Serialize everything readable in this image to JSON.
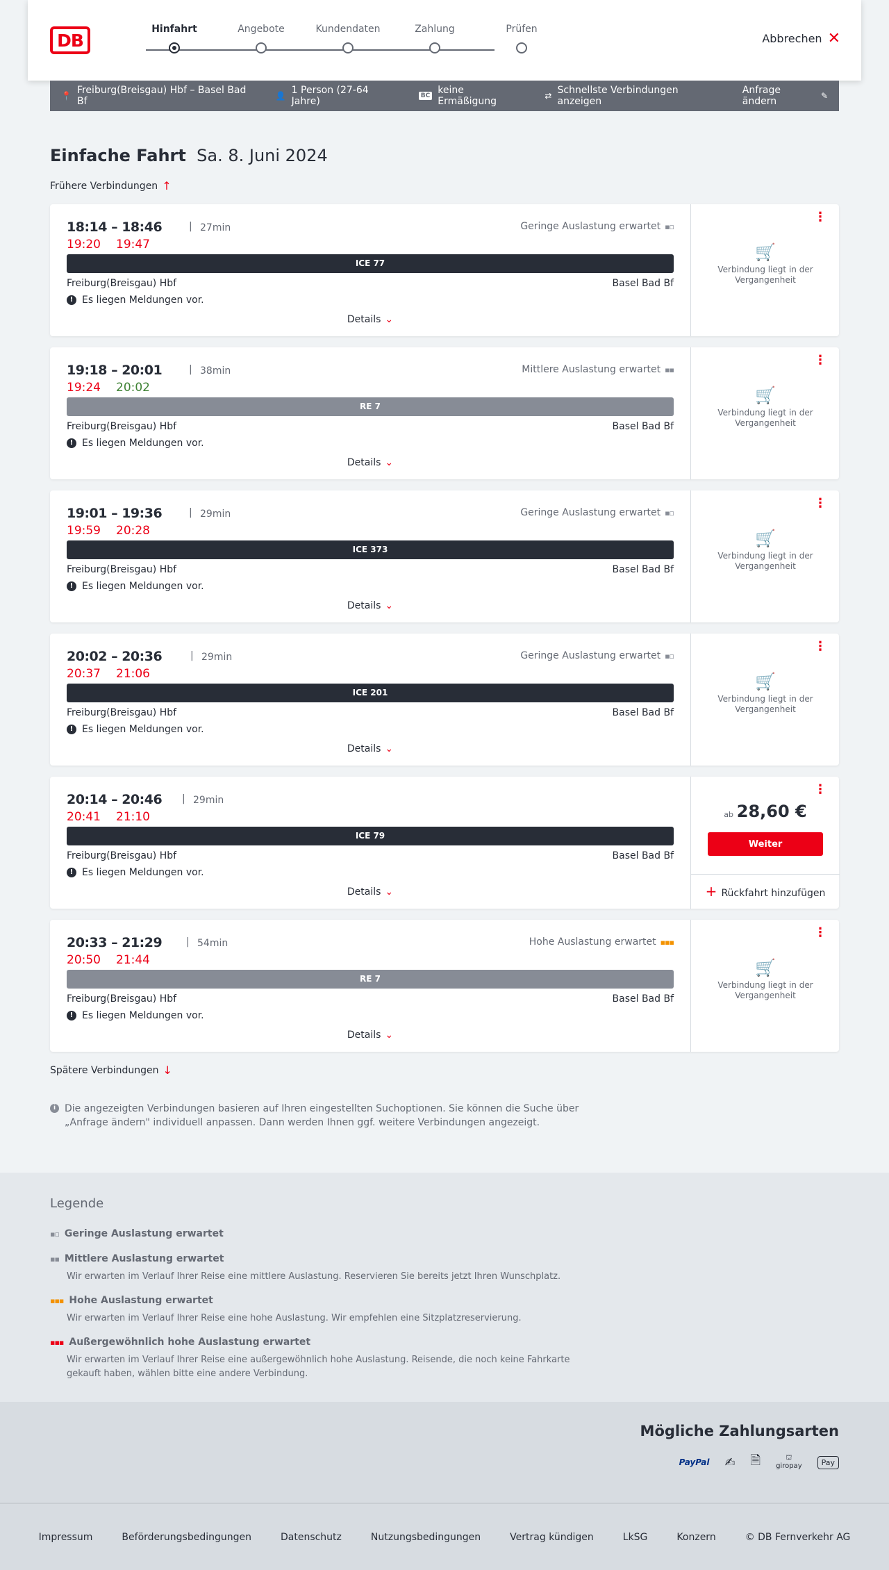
{
  "header": {
    "logo": "DB",
    "steps": [
      "Hinfahrt",
      "Angebote",
      "Kundendaten",
      "Zahlung",
      "Prüfen"
    ],
    "active_step": 0,
    "cancel_label": "Abbrechen"
  },
  "searchbar": {
    "route": "Freiburg(Breisgau) Hbf – Basel Bad Bf",
    "passengers": "1 Person (27-64 Jahre)",
    "discount_badge": "BC",
    "discount": "keine Ermäßigung",
    "fastest": "Schnellste Verbindungen anzeigen",
    "change": "Anfrage ändern"
  },
  "page": {
    "title_bold": "Einfache Fahrt",
    "title_date": "Sa. 8. Juni 2024",
    "earlier": "Frühere Verbindungen",
    "later": "Spätere Verbindungen",
    "info": "Die angezeigten Verbindungen basieren auf Ihren eingestellten Suchoptionen. Sie können die Suche über „Anfrage ändern\" individuell anpassen. Dann werden Ihnen ggf. weitere Verbindungen angezeigt."
  },
  "connections": [
    {
      "times": "18:14 – 18:46",
      "duration": "27min",
      "rt_dep": "19:20",
      "rt_arr": "19:47",
      "arr_green": false,
      "load": "Geringe Auslastung erwartet",
      "load_level": "low",
      "train": "ICE 77",
      "train_type": "ice",
      "from": "Freiburg(Breisgau) Hbf",
      "to": "Basel Bad Bf",
      "message": "Es liegen Meldungen vor.",
      "details": "Details",
      "past": "Verbindung liegt in der Vergangenheit"
    },
    {
      "times": "19:18 – 20:01",
      "duration": "38min",
      "rt_dep": "19:24",
      "rt_arr": "20:02",
      "arr_green": true,
      "load": "Mittlere Auslastung erwartet",
      "load_level": "mid",
      "train": "RE 7",
      "train_type": "re",
      "from": "Freiburg(Breisgau) Hbf",
      "to": "Basel Bad Bf",
      "message": "Es liegen Meldungen vor.",
      "details": "Details",
      "past": "Verbindung liegt in der Vergangenheit"
    },
    {
      "times": "19:01 – 19:36",
      "duration": "29min",
      "rt_dep": "19:59",
      "rt_arr": "20:28",
      "arr_green": false,
      "load": "Geringe Auslastung erwartet",
      "load_level": "low",
      "train": "ICE 373",
      "train_type": "ice",
      "from": "Freiburg(Breisgau) Hbf",
      "to": "Basel Bad Bf",
      "message": "Es liegen Meldungen vor.",
      "details": "Details",
      "past": "Verbindung liegt in der Vergangenheit"
    },
    {
      "times": "20:02 – 20:36",
      "duration": "29min",
      "rt_dep": "20:37",
      "rt_arr": "21:06",
      "arr_green": false,
      "load": "Geringe Auslastung erwartet",
      "load_level": "low",
      "train": "ICE 201",
      "train_type": "ice",
      "from": "Freiburg(Breisgau) Hbf",
      "to": "Basel Bad Bf",
      "message": "Es liegen Meldungen vor.",
      "details": "Details",
      "past": "Verbindung liegt in der Vergangenheit"
    },
    {
      "times": "20:14 – 20:46",
      "duration": "29min",
      "rt_dep": "20:41",
      "rt_arr": "21:10",
      "arr_green": false,
      "load": "",
      "load_level": "",
      "train": "ICE 79",
      "train_type": "ice",
      "from": "Freiburg(Breisgau) Hbf",
      "to": "Basel Bad Bf",
      "message": "Es liegen Meldungen vor.",
      "details": "Details",
      "price_prefix": "ab",
      "price": "28,60 €",
      "button": "Weiter",
      "return": "Rückfahrt hinzufügen"
    },
    {
      "times": "20:33 – 21:29",
      "duration": "54min",
      "rt_dep": "20:50",
      "rt_arr": "21:44",
      "arr_green": false,
      "load": "Hohe Auslastung erwartet",
      "load_level": "high",
      "train": "RE 7",
      "train_type": "re",
      "from": "Freiburg(Breisgau) Hbf",
      "to": "Basel Bad Bf",
      "message": "Es liegen Meldungen vor.",
      "details": "Details",
      "past": "Verbindung liegt in der Vergangenheit"
    }
  ],
  "legend": {
    "title": "Legende",
    "items": [
      {
        "title": "Geringe Auslastung erwartet",
        "desc": ""
      },
      {
        "title": "Mittlere Auslastung erwartet",
        "desc": "Wir erwarten im Verlauf Ihrer Reise eine mittlere Auslastung. Reservieren Sie bereits jetzt Ihren Wunschplatz."
      },
      {
        "title": "Hohe Auslastung erwartet",
        "desc": "Wir erwarten im Verlauf Ihrer Reise eine hohe Auslastung. Wir empfehlen eine Sitzplatzreservierung."
      },
      {
        "title": "Außergewöhnlich hohe Auslastung erwartet",
        "desc": "Wir erwarten im Verlauf Ihrer Reise eine außergewöhnlich hohe Auslastung. Reisende, die noch keine Fahrkarte gekauft haben, wählen bitte eine andere Verbindung."
      }
    ]
  },
  "payment": {
    "title": "Mögliche Zahlungsarten",
    "paypal": "PayPal",
    "sepa": "SEPA",
    "giropay": "giropay",
    "applepay": "Pay"
  },
  "footer": [
    "Impressum",
    "Beförderungsbedingungen",
    "Datenschutz",
    "Nutzungsbedingungen",
    "Vertrag kündigen",
    "LkSG",
    "Konzern",
    "© DB Fernverkehr AG"
  ],
  "colors": {
    "brand": "#ec0016",
    "dark": "#282d37",
    "bar_gray": "#646973",
    "green": "#408335",
    "orange": "#f39200"
  }
}
